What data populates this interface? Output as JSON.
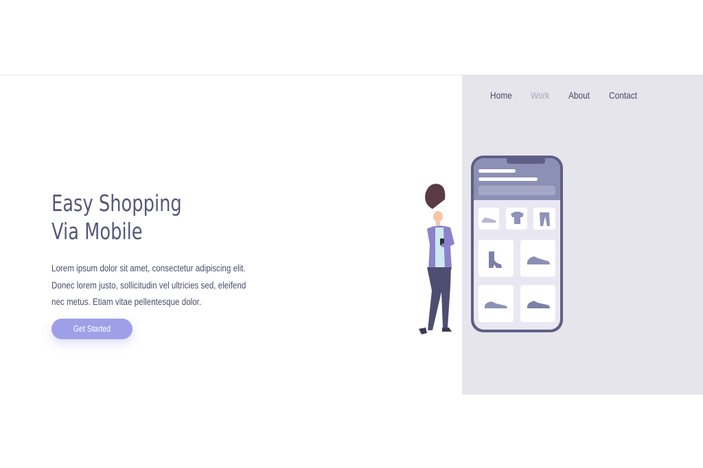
{
  "nav": {
    "items": [
      {
        "label": "Home",
        "active": false
      },
      {
        "label": "Work",
        "active": true
      },
      {
        "label": "About",
        "active": false
      },
      {
        "label": "Contact",
        "active": false
      }
    ]
  },
  "hero": {
    "title_line1": "Easy Shopping",
    "title_line2": "Via Mobile",
    "description_line1": "Lorem ipsum dolor sit amet, consectetur adipiscing elit.",
    "description_line2": "Donec lorem justo, sollicitudin vel ultricies sed, eleifend",
    "description_line3": "nec metus. Etiam vitae pellentesque dolor.",
    "cta_label": "Get Started"
  },
  "illustration": {
    "name": "woman-shopping-on-phone-illustration",
    "product_icons": [
      "sneaker-icon",
      "tshirt-icon",
      "pants-icon",
      "boot-icon",
      "shoe-icon",
      "shoe-icon",
      "shoe-icon"
    ]
  },
  "colors": {
    "accent": "#9da0e6",
    "panel_bg": "#e6e5ec",
    "text_dark": "#4a4a63",
    "text_muted": "#a7a6b8",
    "phone_frame": "#5f5f86"
  }
}
